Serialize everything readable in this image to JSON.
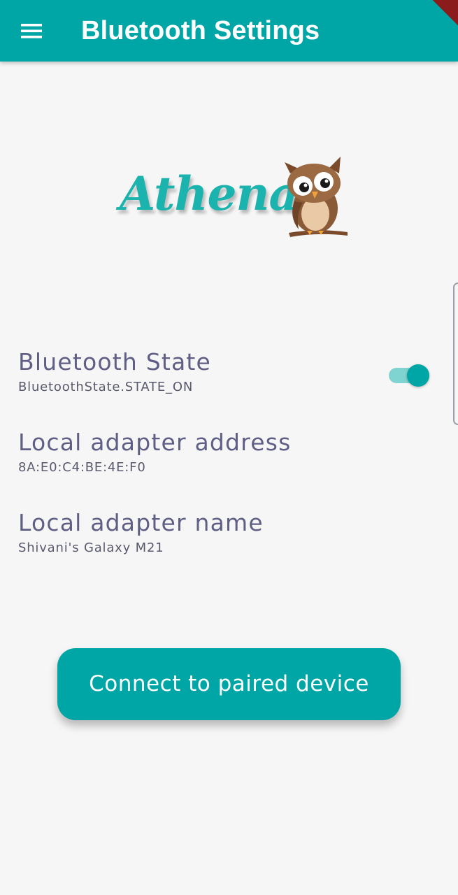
{
  "appbar": {
    "title": "Bluetooth Settings",
    "menu_icon": "hamburger-menu-icon",
    "color": "#00a6a6"
  },
  "logo": {
    "text": "Athena",
    "icon": "owl-icon"
  },
  "settings": {
    "bluetooth_state": {
      "title": "Bluetooth State",
      "value": "BluetoothState.STATE_ON",
      "toggle_on": true
    },
    "local_address": {
      "title": "Local adapter address",
      "value": "8A:E0:C4:BE:4E:F0"
    },
    "local_name": {
      "title": "Local adapter name",
      "value": "Shivani's Galaxy M21"
    }
  },
  "actions": {
    "connect_label": "Connect to paired device"
  }
}
